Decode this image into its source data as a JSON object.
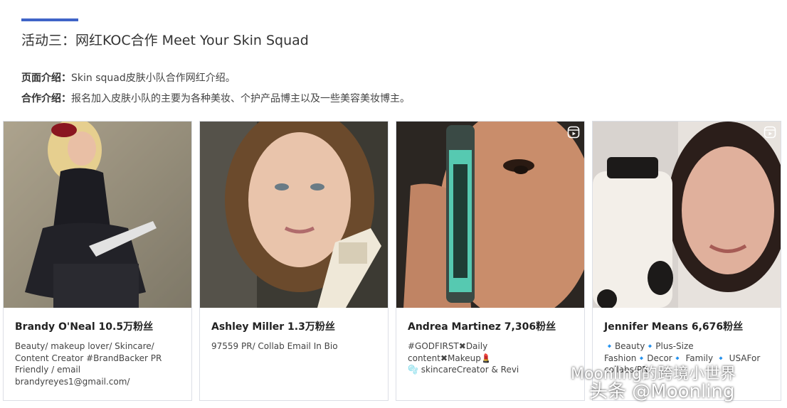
{
  "section": {
    "title": "活动三：网红KOC合作 Meet Your Skin Squad",
    "accent_color": "#3f64c8"
  },
  "intro": {
    "page_label": "页面介绍：",
    "page_text": "Skin squad皮肤小队合作网红介绍。",
    "coop_label": "合作介绍：",
    "coop_text": "报名加入皮肤小队的主要为各种美妆、个护产品博主以及一些美容美妆博主。"
  },
  "cards": [
    {
      "name": "Brandy O'Neal 10.5万粉丝",
      "bio": "Beauty/ makeup lover/ Skincare/\nContent Creator #BrandBacker PR\nFriendly / email\nbrandyreyes1@gmail.com/",
      "has_reel_icon": false
    },
    {
      "name": "Ashley Miller 1.3万粉丝",
      "bio": "97559 PR/ Collab Email In Bio",
      "has_reel_icon": false
    },
    {
      "name": "Andrea Martinez 7,306粉丝",
      "bio": "#GODFIRST✖Daily\ncontent✖Makeup💄\n🫧 skincareCreator & Revi",
      "has_reel_icon": true
    },
    {
      "name": "Jennifer Means 6,676粉丝",
      "bio": "🔹Beauty🔹Plus-Size\nFashion🔹Decor🔹 Family 🔹 USAFor\ncollabs/PR",
      "has_reel_icon": true
    }
  ],
  "watermark": {
    "line1": "Moonling的跨境小世界",
    "line2": "头条 @Moonling"
  }
}
